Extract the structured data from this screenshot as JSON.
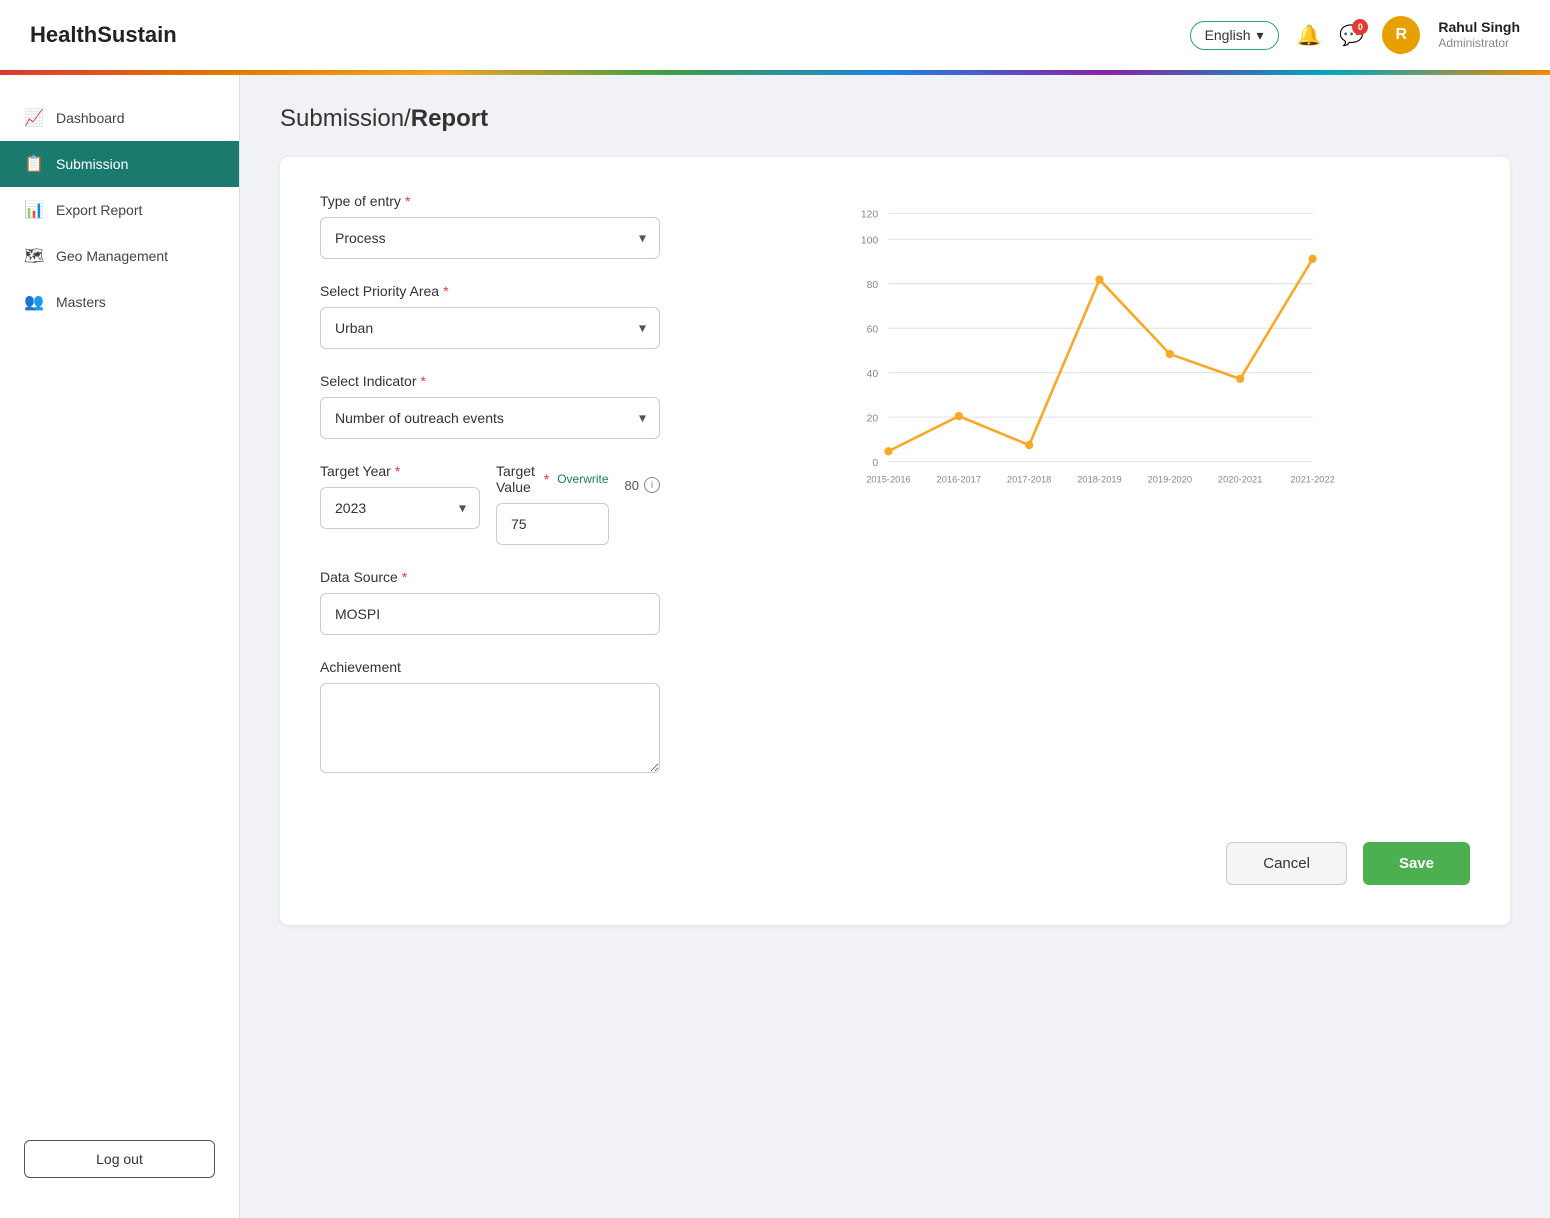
{
  "header": {
    "logo": "HealthSustain",
    "lang_label": "English",
    "lang_chevron": "▾",
    "bell_icon": "🔔",
    "chat_icon": "💬",
    "chat_badge": "0",
    "user_initial": "R",
    "user_name": "Rahul Singh",
    "user_role": "Administrator"
  },
  "sidebar": {
    "items": [
      {
        "id": "dashboard",
        "label": "Dashboard",
        "icon": "📈"
      },
      {
        "id": "submission",
        "label": "Submission",
        "icon": "📋",
        "active": true
      },
      {
        "id": "export-report",
        "label": "Export Report",
        "icon": "📊"
      },
      {
        "id": "geo-management",
        "label": "Geo Management",
        "icon": "🗺"
      },
      {
        "id": "masters",
        "label": "Masters",
        "icon": "👥"
      }
    ],
    "logout_label": "Log out"
  },
  "page": {
    "breadcrumb_prefix": "Submission/",
    "breadcrumb_bold": "Report"
  },
  "form": {
    "type_of_entry_label": "Type of entry",
    "type_of_entry_value": "Process",
    "priority_area_label": "Select Priority Area",
    "priority_area_value": "Urban",
    "indicator_label": "Select Indicator",
    "indicator_value": "Number of outreach events",
    "target_year_label": "Target Year",
    "target_year_value": "2023",
    "target_value_label": "Target Value",
    "overwrite_label": "Overwrite",
    "target_value": "75",
    "target_hint": "80",
    "data_source_label": "Data Source",
    "data_source_value": "MOSPI",
    "achievement_label": "Achievement",
    "achievement_placeholder": ""
  },
  "actions": {
    "cancel_label": "Cancel",
    "save_label": "Save"
  },
  "chart": {
    "labels": [
      "2015-2016",
      "2016-2017",
      "2017-2018",
      "2018-2019",
      "2019-2020",
      "2020-2021",
      "2021-2022"
    ],
    "values": [
      5,
      22,
      8,
      88,
      52,
      40,
      98
    ],
    "y_ticks": [
      0,
      20,
      40,
      60,
      80,
      100,
      120
    ],
    "color": "#f9a825"
  }
}
